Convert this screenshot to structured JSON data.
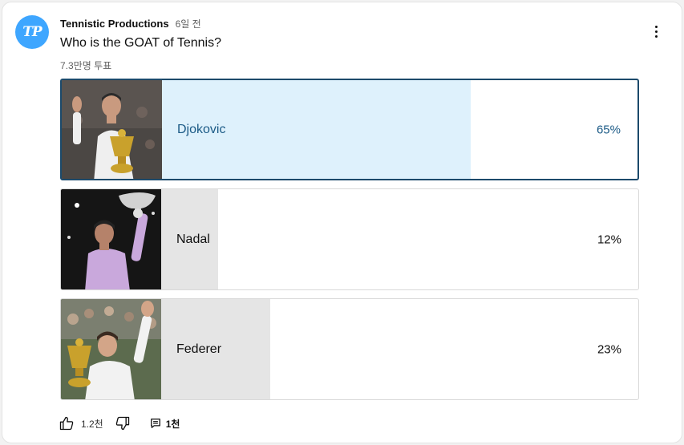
{
  "post": {
    "author": "Tennistic Productions",
    "avatar_text": "TP",
    "time": "6일 전",
    "question": "Who is the GOAT of Tennis?",
    "votes": "7.3만명 투표"
  },
  "options": [
    {
      "label": "Djokovic",
      "percent": "65%",
      "value": 65,
      "selected": true
    },
    {
      "label": "Nadal",
      "percent": "12%",
      "value": 12,
      "selected": false
    },
    {
      "label": "Federer",
      "percent": "23%",
      "value": 23,
      "selected": false
    }
  ],
  "actions": {
    "likes": "1.2천",
    "comments": "1천"
  },
  "icons": {
    "more": "more-vertical-icon",
    "like": "thumbs-up-icon",
    "dislike": "thumbs-down-icon",
    "comment": "comment-icon"
  },
  "colors": {
    "avatar": "#3ea6ff",
    "selected_border": "#1c4a6b",
    "selected_fill": "#def1fc",
    "selected_text": "#1b5a86",
    "unselected_fill": "#e5e5e5"
  }
}
